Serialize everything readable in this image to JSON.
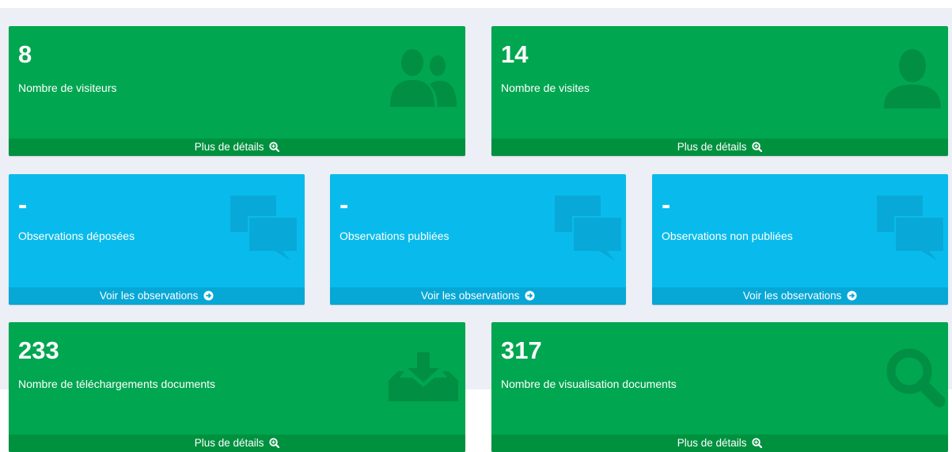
{
  "stats_top": [
    {
      "value": "8",
      "label": "Nombre de visiteurs",
      "link": "Plus de détails",
      "icon": "users-icon"
    },
    {
      "value": "14",
      "label": "Nombre de visites",
      "link": "Plus de détails",
      "icon": "user-icon"
    }
  ],
  "observations": [
    {
      "value": "-",
      "label": "Observations déposées",
      "link": "Voir les observations",
      "icon": "comments-icon"
    },
    {
      "value": "-",
      "label": "Observations publiées",
      "link": "Voir les observations",
      "icon": "comments-icon"
    },
    {
      "value": "-",
      "label": "Observations non publiées",
      "link": "Voir les observations",
      "icon": "comments-icon"
    }
  ],
  "stats_bottom": [
    {
      "value": "233",
      "label": "Nombre de téléchargements documents",
      "link": "Plus de détails",
      "icon": "download-tray-icon"
    },
    {
      "value": "317",
      "label": "Nombre de visualisation documents",
      "link": "Plus de détails",
      "icon": "search-icon"
    }
  ],
  "colors": {
    "green": "#00a650",
    "green_dark": "#00913f",
    "blue": "#09bbec",
    "blue_dark": "#07a7d6"
  }
}
